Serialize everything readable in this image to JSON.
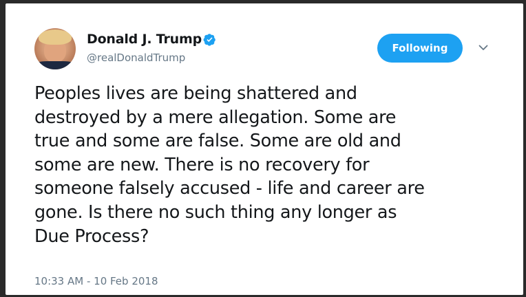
{
  "author": {
    "name": "Donald J. Trump",
    "handle": "@realDonaldTrump",
    "verified": true
  },
  "follow_button": {
    "label": "Following",
    "color": "#1da1f2"
  },
  "menu": {
    "icon": "chevron-down-icon"
  },
  "tweet": {
    "lines": [
      "Peoples lives are being shattered and",
      "destroyed by a mere allegation. Some are",
      "true and some are false. Some are old and",
      "some are new. There is no recovery for",
      "someone falsely accused - life and career are",
      "gone. Is there no such thing any longer as",
      "Due Process?"
    ],
    "timestamp": "10:33 AM - 10 Feb 2018"
  },
  "colors": {
    "text": "#14171a",
    "secondary": "#657786",
    "verified_badge": "#1da1f2"
  }
}
